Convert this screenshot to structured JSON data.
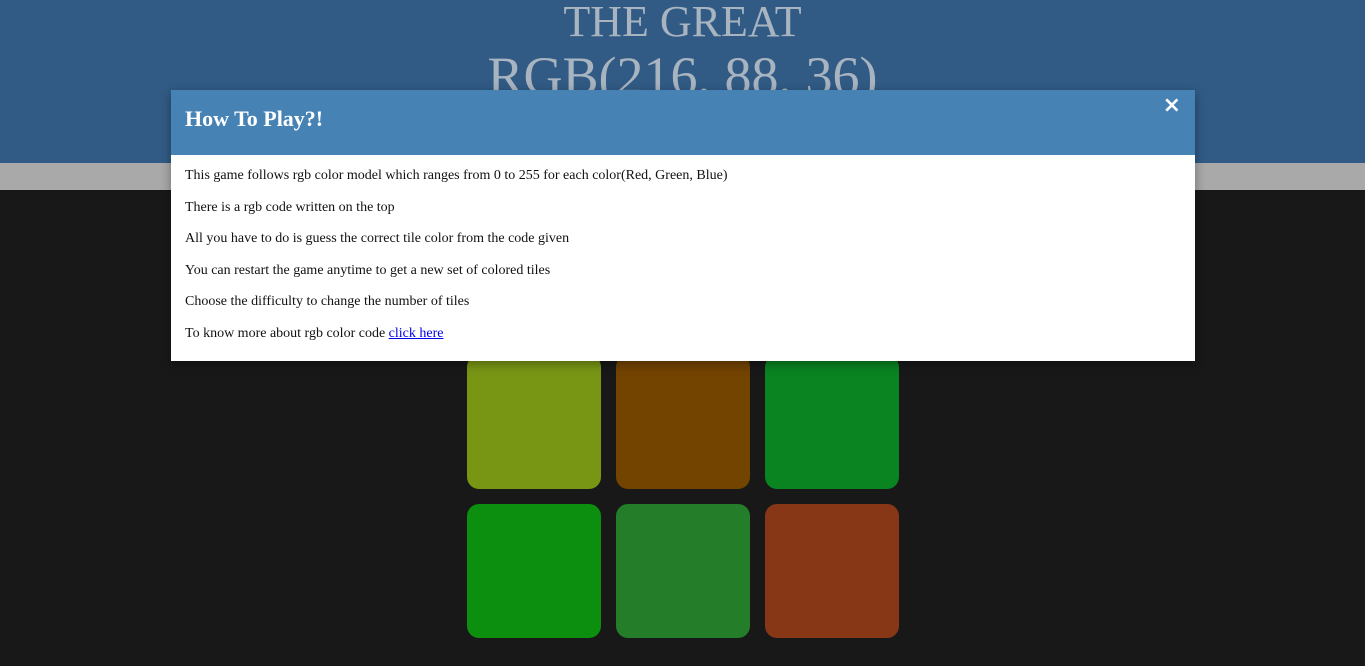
{
  "header": {
    "title_line1": "THE GREAT",
    "title_line2": "RGB(216, 88, 36)"
  },
  "tiles": [
    {
      "color": "#789614"
    },
    {
      "color": "#734300"
    },
    {
      "color": "#0a8421"
    },
    {
      "color": "#0c8e0e"
    },
    {
      "color": "#247d29"
    },
    {
      "color": "#873616"
    }
  ],
  "modal": {
    "title": "How To Play?!",
    "close_label": "×",
    "lines": [
      "This game follows rgb color model which ranges from 0 to 255 for each color(Red, Green, Blue)",
      "There is a rgb code written on the top",
      "All you have to do is guess the correct tile color from the code given",
      "You can restart the game anytime to get a new set of colored tiles",
      "Choose the difficulty to change the number of tiles"
    ],
    "more_text": "To know more about rgb color code ",
    "more_link": "click here"
  },
  "colors": {
    "header_bg": "#315b85",
    "modal_header_bg": "#4682b4",
    "page_bg": "#181818",
    "stripe_bg": "#a9a9a9"
  }
}
